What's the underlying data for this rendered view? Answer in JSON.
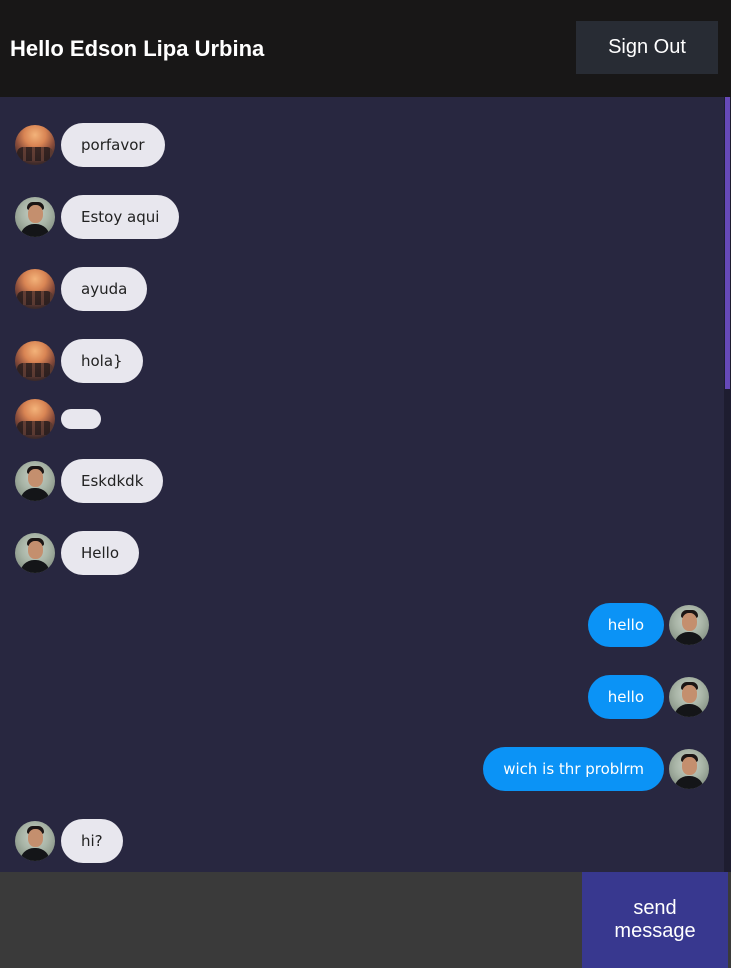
{
  "header": {
    "title": "Hello Edson Lipa Urbina",
    "sign_out_label": "Sign Out"
  },
  "messages": [
    {
      "text": "porfavor",
      "direction": "received",
      "avatar": "sunset-avatar"
    },
    {
      "text": "Estoy aqui",
      "direction": "received",
      "avatar": "person-avatar"
    },
    {
      "text": "ayuda",
      "direction": "received",
      "avatar": "sunset-avatar"
    },
    {
      "text": "hola}",
      "direction": "received",
      "avatar": "sunset-avatar"
    },
    {
      "text": "",
      "direction": "received",
      "avatar": "sunset-avatar"
    },
    {
      "text": "Eskdkdk",
      "direction": "received",
      "avatar": "person-avatar"
    },
    {
      "text": "Hello",
      "direction": "received",
      "avatar": "person-avatar"
    },
    {
      "text": "hello",
      "direction": "sent",
      "avatar": "person-avatar"
    },
    {
      "text": "hello",
      "direction": "sent",
      "avatar": "person-avatar"
    },
    {
      "text": "wich is thr problrm",
      "direction": "sent",
      "avatar": "person-avatar"
    },
    {
      "text": "hi?",
      "direction": "received",
      "avatar": "person-avatar"
    }
  ],
  "composer": {
    "input_value": "",
    "send_label": "send message"
  },
  "colors": {
    "chat_background": "#282740",
    "header_background": "#181717",
    "received_bubble": "#e8e7ee",
    "sent_bubble": "#0b93f6",
    "send_button": "#38388f",
    "scrollbar_thumb": "#6649b8"
  }
}
